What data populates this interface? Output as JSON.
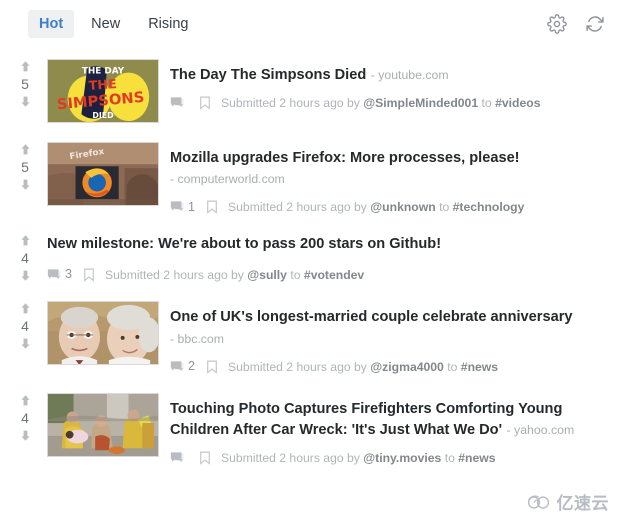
{
  "header": {
    "tabs": [
      {
        "label": "Hot",
        "active": true
      },
      {
        "label": "New",
        "active": false
      },
      {
        "label": "Rising",
        "active": false
      }
    ],
    "settings_icon": "gear-icon",
    "refresh_icon": "refresh-icon"
  },
  "posts": [
    {
      "score": "5",
      "title": "The Day The Simpsons Died",
      "domain": "- youtube.com",
      "comments": "",
      "submitted_prefix": "Submitted 2 hours ago by",
      "user": "@SimpleMinded001",
      "to_word": "to",
      "tag": "#videos",
      "thumbnail": "simpsons-thumbnail",
      "has_thumbnail": true
    },
    {
      "score": "5",
      "title": "Mozilla upgrades Firefox: More processes, please!",
      "domain": "- computerworld.com",
      "comments": "1",
      "submitted_prefix": "Submitted 2 hours ago by",
      "user": "@unknown",
      "to_word": "to",
      "tag": "#technology",
      "thumbnail": "firefox-thumbnail",
      "has_thumbnail": true
    },
    {
      "score": "4",
      "title": "New milestone: We're about to pass 200 stars on Github!",
      "domain": "",
      "comments": "3",
      "submitted_prefix": "Submitted 2 hours ago by",
      "user": "@sully",
      "to_word": "to",
      "tag": "#votendev",
      "thumbnail": "",
      "has_thumbnail": false
    },
    {
      "score": "4",
      "title": "One of UK's longest-married couple celebrate anniversary",
      "domain": "- bbc.com",
      "comments": "2",
      "submitted_prefix": "Submitted 2 hours ago by",
      "user": "@zigma4000",
      "to_word": "to",
      "tag": "#news",
      "thumbnail": "elderly-couple-thumbnail",
      "has_thumbnail": true
    },
    {
      "score": "4",
      "title": "Touching Photo Captures Firefighters Comforting Young Children After Car Wreck: 'It's Just What We Do'",
      "domain": "- yahoo.com",
      "comments": "",
      "submitted_prefix": "Submitted 2 hours ago by",
      "user": "@tiny.movies",
      "to_word": "to",
      "tag": "#news",
      "thumbnail": "firefighters-thumbnail",
      "has_thumbnail": true
    }
  ],
  "watermark": {
    "text": "亿速云"
  },
  "colors": {
    "accent": "#3c7fd0",
    "tab_active_bg": "#eef0f2",
    "title": "#26292c",
    "muted": "#b0b4b8",
    "meta_strong": "#83878c"
  }
}
